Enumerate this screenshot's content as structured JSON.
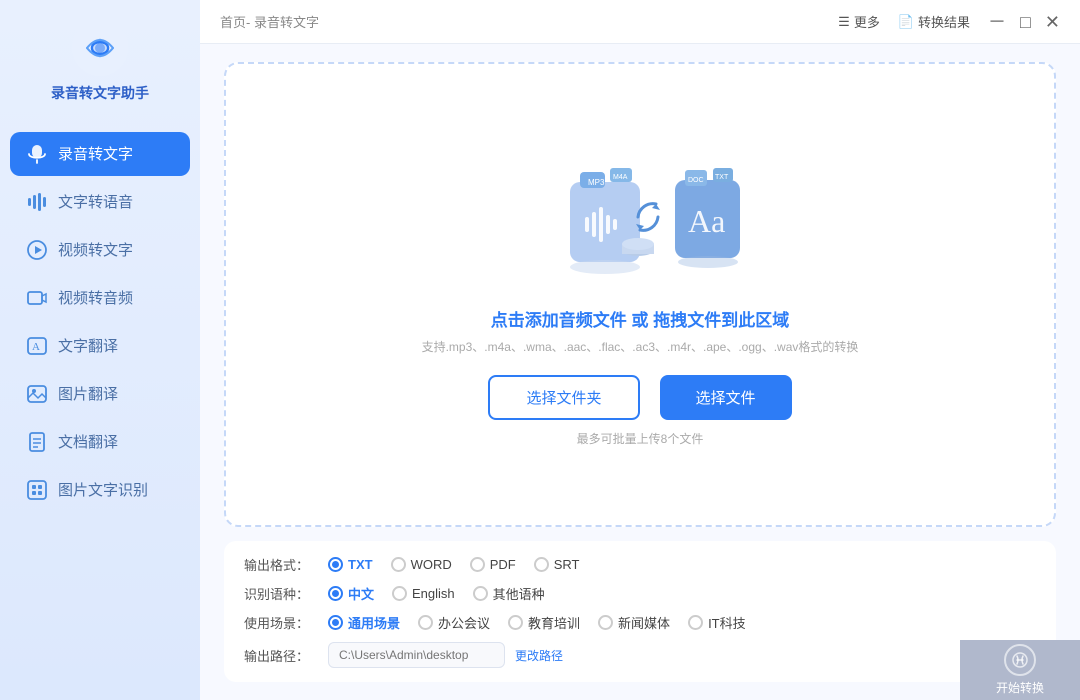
{
  "sidebar": {
    "logo_title": "录音转文字助手",
    "items": [
      {
        "id": "speech-to-text",
        "label": "录音转文字",
        "active": true
      },
      {
        "id": "text-to-speech",
        "label": "文字转语音",
        "active": false
      },
      {
        "id": "video-to-text",
        "label": "视频转文字",
        "active": false
      },
      {
        "id": "video-to-audio",
        "label": "视频转音频",
        "active": false
      },
      {
        "id": "text-translate",
        "label": "文字翻译",
        "active": false
      },
      {
        "id": "image-translate",
        "label": "图片翻译",
        "active": false
      },
      {
        "id": "doc-translate",
        "label": "文档翻译",
        "active": false
      },
      {
        "id": "image-ocr",
        "label": "图片文字识别",
        "active": false
      }
    ]
  },
  "titlebar": {
    "breadcrumb": "首页- 录音转文字",
    "more_label": "更多",
    "result_label": "转换结果"
  },
  "drop_area": {
    "main_text": "点击添加音频文件 或 拖拽文件到此区域",
    "sub_text": "支持.mp3、.m4a、.wma、.aac、.flac、.ac3、.m4r、.ape、.ogg、.wav格式的转换",
    "btn_folder": "选择文件夹",
    "btn_file": "选择文件",
    "hint": "最多可批量上传8个文件"
  },
  "settings": {
    "format_label": "输出格式：",
    "formats": [
      "TXT",
      "WORD",
      "PDF",
      "SRT"
    ],
    "format_selected": "TXT",
    "lang_label": "识别语种：",
    "langs": [
      "中文",
      "English",
      "其他语种"
    ],
    "lang_selected": "中文",
    "scene_label": "使用场景：",
    "scenes": [
      "通用场景",
      "办公会议",
      "教育培训",
      "新闻媒体",
      "IT科技"
    ],
    "scene_selected": "通用场景",
    "path_label": "输出路径：",
    "path_placeholder": "C:\\Users\\Admin\\desktop",
    "path_change": "更改路径"
  },
  "start_button": {
    "label": "开始转换"
  }
}
